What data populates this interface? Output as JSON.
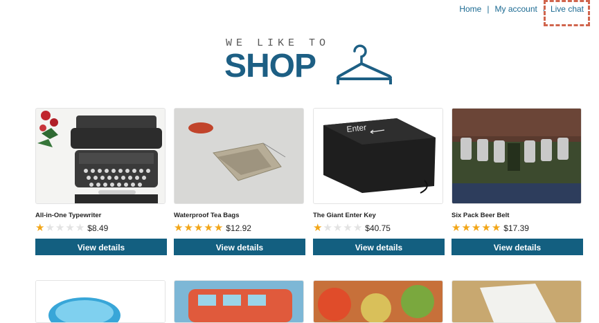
{
  "nav": {
    "home": "Home",
    "account": "My account",
    "chat": "Live chat",
    "separator": "|"
  },
  "logo": {
    "tagline": "WE LIKE TO",
    "word": "SHOP",
    "icon": "hanger-icon"
  },
  "colors": {
    "accent": "#135f80",
    "link": "#1b6a92",
    "star": "#f2a618",
    "highlight": "#d0654d"
  },
  "products": [
    {
      "name": "All-in-One Typewriter",
      "rating": 1,
      "price": "$8.49",
      "button": "View details"
    },
    {
      "name": "Waterproof Tea Bags",
      "rating": 5,
      "price": "$12.92",
      "button": "View details"
    },
    {
      "name": "The Giant Enter Key",
      "rating": 1,
      "price": "$40.75",
      "button": "View details"
    },
    {
      "name": "Six Pack Beer Belt",
      "rating": 5,
      "price": "$17.39",
      "button": "View details"
    }
  ]
}
